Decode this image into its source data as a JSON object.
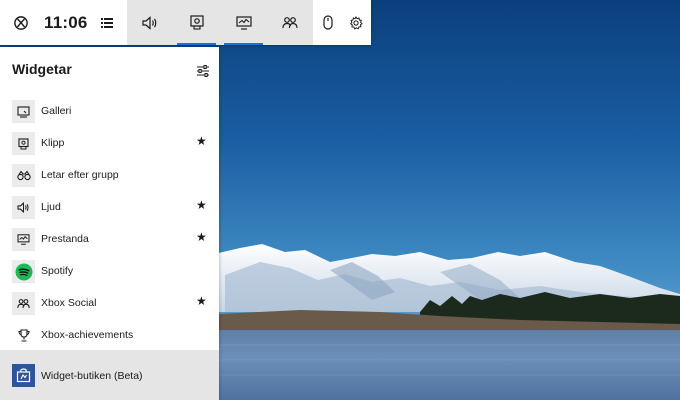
{
  "gamebar": {
    "time": "11:06",
    "buttons": [
      {
        "name": "xbox-logo-icon",
        "active": false
      },
      {
        "name": "menu-icon",
        "active": false
      },
      {
        "name": "audio-icon",
        "active": false
      },
      {
        "name": "capture-icon",
        "active": true
      },
      {
        "name": "performance-icon",
        "active": true
      },
      {
        "name": "xbox-social-icon",
        "active": false
      },
      {
        "name": "mouse-icon",
        "active": false
      },
      {
        "name": "settings-gear-icon",
        "active": false
      }
    ]
  },
  "panel": {
    "title": "Widgetar",
    "items": [
      {
        "label": "Galleri",
        "icon": "gallery-icon",
        "favorite": false
      },
      {
        "label": "Klipp",
        "icon": "capture-icon",
        "favorite": true
      },
      {
        "label": "Letar efter grupp",
        "icon": "binoculars-icon",
        "favorite": false
      },
      {
        "label": "Ljud",
        "icon": "audio-icon",
        "favorite": true
      },
      {
        "label": "Prestanda",
        "icon": "performance-icon",
        "favorite": true
      },
      {
        "label": "Spotify",
        "icon": "spotify-icon",
        "favorite": false
      },
      {
        "label": "Xbox Social",
        "icon": "xbox-social-icon",
        "favorite": true
      },
      {
        "label": "Xbox-achievements",
        "icon": "trophy-icon",
        "favorite": false
      }
    ],
    "store": {
      "label": "Widget-butiken (Beta)",
      "icon": "widget-store-icon"
    },
    "favorite_glyph": "★"
  },
  "colors": {
    "accent": "#1e6fd9",
    "spotify": "#1db954",
    "store_icon": "#2b5797",
    "bar_mid": "#e5e5e5"
  }
}
